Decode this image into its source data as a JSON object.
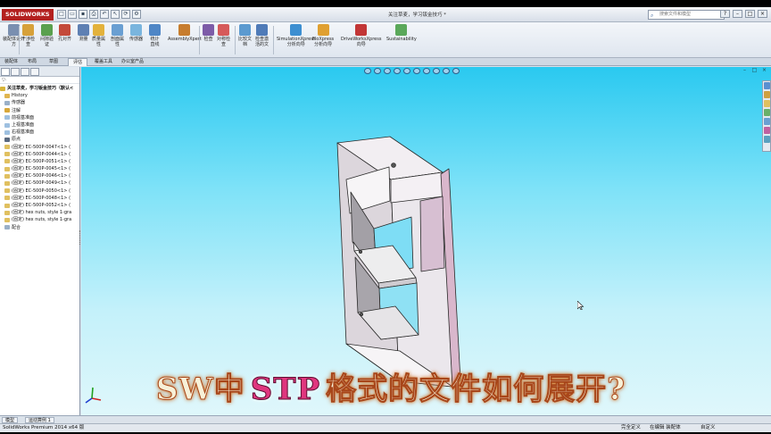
{
  "app": {
    "logo": "SOLIDWORKS",
    "doc_title": "关注草麦，学习钣金技巧 *",
    "search_placeholder": "搜索文件和模型"
  },
  "ribbon": {
    "buttons": [
      {
        "label": "装配体设计\n方",
        "color": "#7a8fb0"
      },
      {
        "label": "干涉检\n查",
        "color": "#d7a13a"
      },
      {
        "label": "间隙验\n证",
        "color": "#5aa04e"
      },
      {
        "label": "孔对齐",
        "color": "#c44a3a"
      },
      {
        "label": "测量",
        "color": "#5e80b3"
      },
      {
        "label": "质量属\n性",
        "color": "#e3b23c"
      },
      {
        "label": "剖面属\n性",
        "color": "#6a9fd2"
      },
      {
        "label": "传感器",
        "color": "#7ab5de"
      },
      {
        "label": "统计\n直线",
        "color": "#4f86c6"
      },
      {
        "label": "AssemblyXpert",
        "color": "#c77d2e"
      },
      {
        "label": "检查",
        "color": "#7d5ca8"
      },
      {
        "label": "对称检\n查",
        "color": "#d65a5a"
      },
      {
        "label": "比较文\n档",
        "color": "#5b9ad0"
      },
      {
        "label": "检查激\n活的文",
        "color": "#4f7bb8"
      },
      {
        "label": "SimulationXpress\n分析向导",
        "color": "#3d8fd1"
      },
      {
        "label": "FloXpress\n分析向导",
        "color": "#e0a030"
      },
      {
        "label": "DriveWorksXpress\n向导",
        "color": "#c23636"
      },
      {
        "label": "Sustainability",
        "color": "#5aa85a"
      }
    ]
  },
  "tabs": [
    "装配体",
    "布局",
    "草图",
    "评估",
    "覆盖工具",
    "办公室产品"
  ],
  "tabs_active": "评估",
  "tree": {
    "filter": "▽·",
    "items": [
      {
        "label": "关注草麦，学习钣金技巧（默认<",
        "color": "#d8b53a",
        "root": true
      },
      {
        "label": "History",
        "color": "#e0b550"
      },
      {
        "label": "传感器",
        "color": "#9ab0c8"
      },
      {
        "label": "注解",
        "color": "#d8a83a"
      },
      {
        "label": "前视基准面",
        "color": "#9ec0e0"
      },
      {
        "label": "上视基准面",
        "color": "#9ec0e0"
      },
      {
        "label": "右视基准面",
        "color": "#9ec0e0"
      },
      {
        "label": "原点",
        "color": "#5a6a80"
      },
      {
        "label": "(固定) EC-500P-0047<1> (",
        "color": "#e0c060"
      },
      {
        "label": "(固定) EC-500P-0044<1> (",
        "color": "#e0c060"
      },
      {
        "label": "(固定) EC-500P-0051<1> (",
        "color": "#e0c060"
      },
      {
        "label": "(固定) EC-500P-0045<1> (",
        "color": "#e0c060"
      },
      {
        "label": "(固定) EC-500P-0046<1> (",
        "color": "#e0c060"
      },
      {
        "label": "(固定) EC-500P-0049<1> (",
        "color": "#e0c060"
      },
      {
        "label": "(固定) EC-500P-0050<1> (",
        "color": "#e0c060"
      },
      {
        "label": "(固定) EC-500P-0048<1> (",
        "color": "#e0c060"
      },
      {
        "label": "(固定) EC-500P-0052<1> (",
        "color": "#e0c060"
      },
      {
        "label": "(固定) hex nuts, style 1-gra",
        "color": "#e0c060"
      },
      {
        "label": "(固定) hex nuts, style 1-gra",
        "color": "#e0c060"
      },
      {
        "label": "配合",
        "color": "#9ab0c8"
      }
    ]
  },
  "caption": {
    "pre": "SW中",
    "highlight": "STP",
    "post": "格式的文件如何展开?"
  },
  "bottom_tabs": [
    "模型",
    "运动算例 1"
  ],
  "status": {
    "product": "SolidWorks Premium 2014 x64 版",
    "right_1": "完全定义",
    "right_2": "在编辑 装配体",
    "right_3": "自定义"
  }
}
